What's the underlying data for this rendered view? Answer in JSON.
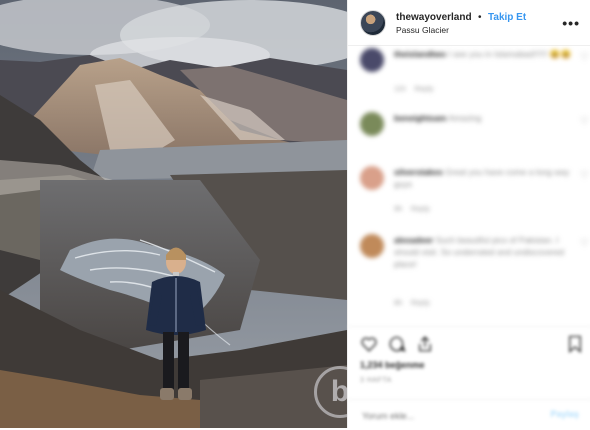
{
  "header": {
    "username": "thewayoverland",
    "separator": "•",
    "follow_label": "Takip Et",
    "location": "Passu Glacier",
    "more_label": "•••"
  },
  "watermark": {
    "letter": "b"
  },
  "comments": [
    {
      "user": "theislandtwo",
      "text": "I see you in Islamabad!!!!!! 😃😃",
      "meta_time": "11h",
      "meta_reply": "Reply",
      "avatar_color": "#4a4a6a"
    },
    {
      "user": "beneightsam",
      "text": "Amazing",
      "meta_time": "",
      "meta_reply": "",
      "avatar_color": "#7a8a5a"
    },
    {
      "user": "silverstakes",
      "text": "Great you have come a long way guys",
      "meta_time": "9h",
      "meta_reply": "Reply",
      "avatar_color": "#d9a08a"
    },
    {
      "user": "alexadeer",
      "text": "Such beautiful pics of Pakistan. I should visit. So underrated and undiscovered place!",
      "meta_time": "8h",
      "meta_reply": "Reply",
      "avatar_color": "#c08a5a"
    }
  ],
  "actions": {
    "likes": "1,234 beğenme",
    "time": "3 HAFTA",
    "comment_placeholder": "Yorum ekle...",
    "post_label": "Paylaş"
  },
  "colors": {
    "accent": "#3897f0",
    "text": "#262626",
    "muted": "#8e8e8e"
  }
}
